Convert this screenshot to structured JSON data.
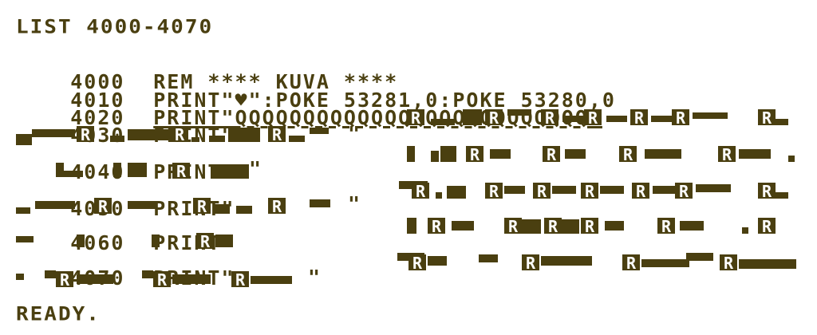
{
  "screen": {
    "bg_color": "#ffffff",
    "fg_color": "#4a3f10",
    "command": "LIST 4000-4070",
    "ready": "READY."
  },
  "listing": [
    {
      "line_no": "4000",
      "text": "REM **** KUVA ****"
    },
    {
      "line_no": "4010",
      "text": "PRINT\"♥\":POKE 53281,0:POKE 53280,0"
    },
    {
      "line_no": "4020",
      "text": "PRINT\"QQQQQQQQQQQQQQQQQQQQQQQQQQ\""
    },
    {
      "line_no": "4030",
      "text": "PRINT\""
    },
    {
      "line_no": "4040",
      "text": "PRINT\""
    },
    {
      "line_no": "4050",
      "text": "PRINT\""
    },
    {
      "line_no": "4060",
      "text": "PRINT\""
    },
    {
      "line_no": "4070",
      "text": "PRINT\""
    }
  ],
  "reverse_glyph": "R",
  "quote": "\""
}
